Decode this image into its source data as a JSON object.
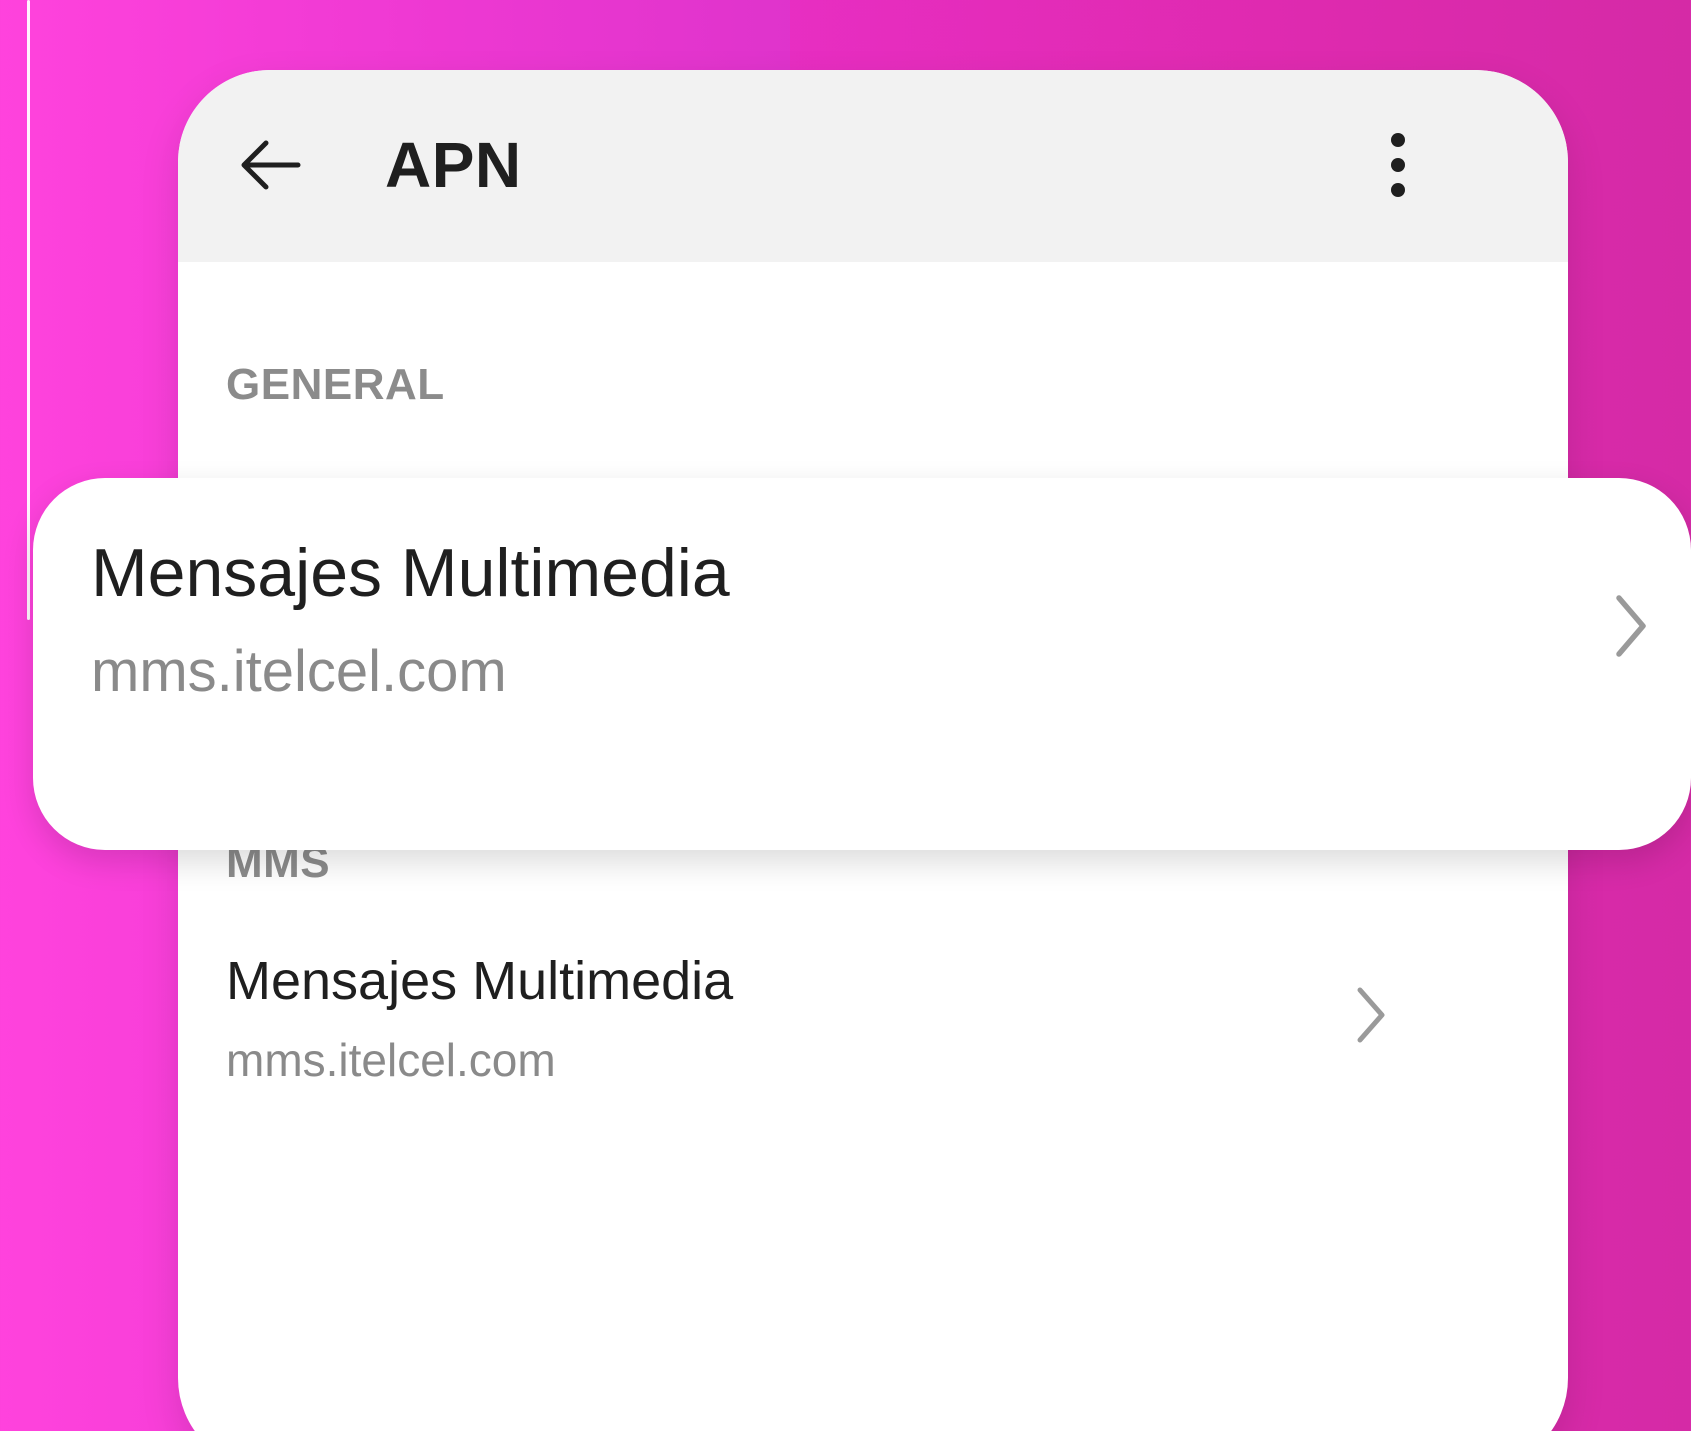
{
  "app_bar": {
    "title": "APN",
    "back_icon": "arrow-left-icon",
    "menu_icon": "more-vertical-icon"
  },
  "sections": {
    "general_header": "GENERAL",
    "mms_header": "MMS"
  },
  "mms_item": {
    "title": "Mensajes Multimedia",
    "subtitle": "mms.itelcel.com",
    "chevron_icon": "chevron-right-icon"
  },
  "highlight_item": {
    "title": "Mensajes Multimedia",
    "subtitle": "mms.itelcel.com",
    "chevron_icon": "chevron-right-icon"
  },
  "colors": {
    "background_pink": "#e82ec3",
    "app_bar": "#f2f2f2",
    "card": "#ffffff",
    "title_text": "#1f1f1f",
    "secondary_text": "#8a8a8a"
  }
}
